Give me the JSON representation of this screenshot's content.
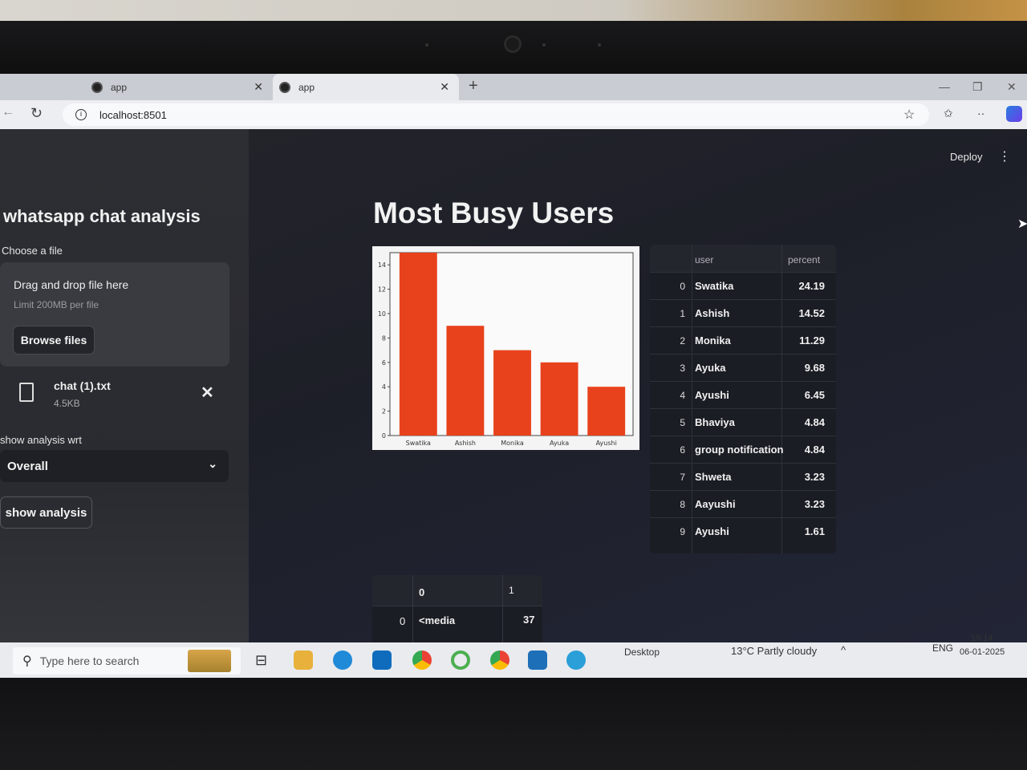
{
  "browser": {
    "tabs": [
      {
        "label": "app",
        "close": "✕"
      },
      {
        "label": "app",
        "close": "✕"
      }
    ],
    "new_tab": "+",
    "window_controls": {
      "minimize": "—",
      "restore": "❐",
      "close": "✕"
    },
    "url": "localhost:8501",
    "info_glyph": "i",
    "reload_glyph": "↻",
    "back_glyph": "←",
    "favorite_glyph": "☆",
    "favorites_glyph": "✩",
    "more_glyph": "··"
  },
  "app": {
    "deploy_label": "Deploy",
    "menu_glyph": "⋮",
    "cursor_glyph": "➤",
    "sidebar": {
      "title": "whatsapp chat analysis",
      "uploader_label": "Choose a file",
      "dropzone_text": "Drag and drop file here",
      "dropzone_limit": "Limit 200MB per file",
      "browse_button": "Browse files",
      "file": {
        "name": "chat (1).txt",
        "size": "4.5KB",
        "remove_glyph": "✕"
      },
      "select_label": "show analysis wrt",
      "select_value": "Overall",
      "select_chevron": "⌄",
      "show_button": "show analysis"
    },
    "main_title": "Most Busy Users",
    "users_table": {
      "columns": [
        "",
        "user",
        "percent"
      ],
      "rows": [
        {
          "index": "0",
          "user": "Swatika",
          "percent": "24.19"
        },
        {
          "index": "1",
          "user": "Ashish",
          "percent": "14.52"
        },
        {
          "index": "2",
          "user": "Monika",
          "percent": "11.29"
        },
        {
          "index": "3",
          "user": "Ayuka",
          "percent": "9.68"
        },
        {
          "index": "4",
          "user": "Ayushi",
          "percent": "6.45"
        },
        {
          "index": "5",
          "user": "Bhaviya",
          "percent": "4.84"
        },
        {
          "index": "6",
          "user": "group notification",
          "percent": "4.84"
        },
        {
          "index": "7",
          "user": "Shweta",
          "percent": "3.23"
        },
        {
          "index": "8",
          "user": "Aayushi",
          "percent": "3.23"
        },
        {
          "index": "9",
          "user": "Ayushi",
          "percent": "1.61"
        }
      ]
    },
    "media_table": {
      "columns": [
        "",
        "0",
        "1"
      ],
      "rows": [
        {
          "index": "0",
          "c0": "<media",
          "c1": "37"
        }
      ]
    }
  },
  "chart_data": {
    "type": "bar",
    "categories": [
      "Swatika",
      "Ashish",
      "Monika",
      "Ayuka",
      "Ayushi"
    ],
    "values": [
      15,
      9,
      7,
      6,
      4
    ],
    "ylim": [
      0,
      15
    ],
    "yticks": [
      0,
      2,
      4,
      6,
      8,
      10,
      12,
      14
    ],
    "bar_color": "#e8421c",
    "grid": false,
    "legend": "none"
  },
  "taskbar": {
    "search_glyph": "⚲",
    "search_placeholder": "Type here to search",
    "taskview_glyph": "⊟",
    "desktop_label": "Desktop",
    "weather": "13°C  Partly cloudy",
    "chevron_glyph": "^",
    "language": "ENG",
    "time": "19:14",
    "date": "06-01-2025"
  },
  "colors": {
    "accent_bar": "#e8421c",
    "app_bg": "#23242b",
    "sidebar_bg": "#2d2e33"
  }
}
